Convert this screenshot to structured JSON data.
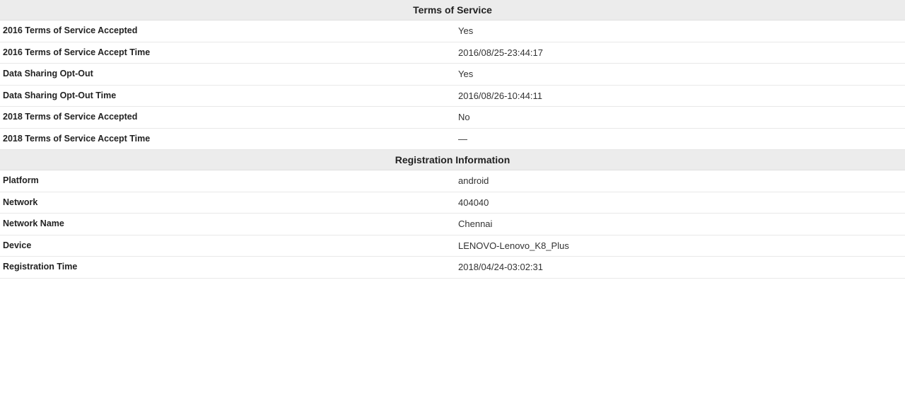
{
  "sections": {
    "tos": {
      "header": "Terms of Service",
      "rows": [
        {
          "label": "2016 Terms of Service Accepted",
          "value": "Yes"
        },
        {
          "label": "2016 Terms of Service Accept Time",
          "value": "2016/08/25-23:44:17"
        },
        {
          "label": "Data Sharing Opt-Out",
          "value": "Yes"
        },
        {
          "label": "Data Sharing Opt-Out Time",
          "value": "2016/08/26-10:44:11"
        },
        {
          "label": "2018 Terms of Service Accepted",
          "value": "No"
        },
        {
          "label": "2018 Terms of Service Accept Time",
          "value": "—"
        }
      ]
    },
    "reg": {
      "header": "Registration Information",
      "rows": [
        {
          "label": "Platform",
          "value": "android"
        },
        {
          "label": "Network",
          "value": "404040"
        },
        {
          "label": "Network Name",
          "value": "Chennai"
        },
        {
          "label": "Device",
          "value": "LENOVO-Lenovo_K8_Plus"
        },
        {
          "label": "Registration Time",
          "value": "2018/04/24-03:02:31"
        }
      ]
    }
  }
}
